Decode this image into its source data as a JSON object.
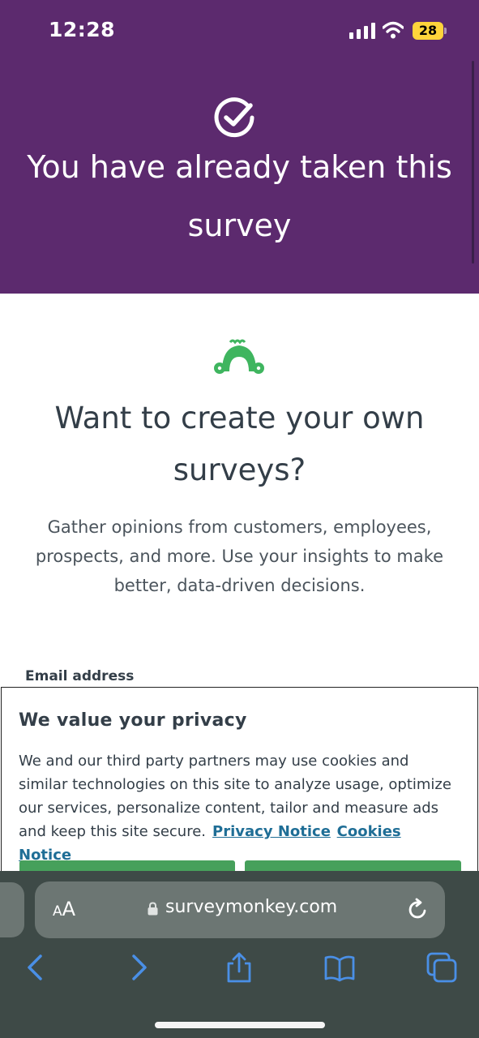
{
  "status_bar": {
    "time": "12:28",
    "battery": "28"
  },
  "hero": {
    "title": "You have already taken this survey"
  },
  "promo": {
    "title": "Want to create your own surveys?",
    "description": "Gather opinions from customers, employees, prospects, and more. Use your insights to make better, data-driven decisions.",
    "email_label": "Email address"
  },
  "privacy": {
    "title": "We value your privacy",
    "body": "We and our third party partners may use cookies and similar technologies on this site to analyze usage, optimize our services, personalize content, tailor and measure ads and keep this site secure.",
    "privacy_link": "Privacy Notice",
    "cookies_link": "Cookies Notice"
  },
  "browser": {
    "text_size_label_small": "A",
    "text_size_label_large": "A",
    "url": "surveymonkey.com"
  },
  "colors": {
    "hero_bg": "#5c2a6e",
    "brand_green": "#46a05b",
    "link": "#1f6e96",
    "toolbar_blue": "#4a8fe6"
  }
}
